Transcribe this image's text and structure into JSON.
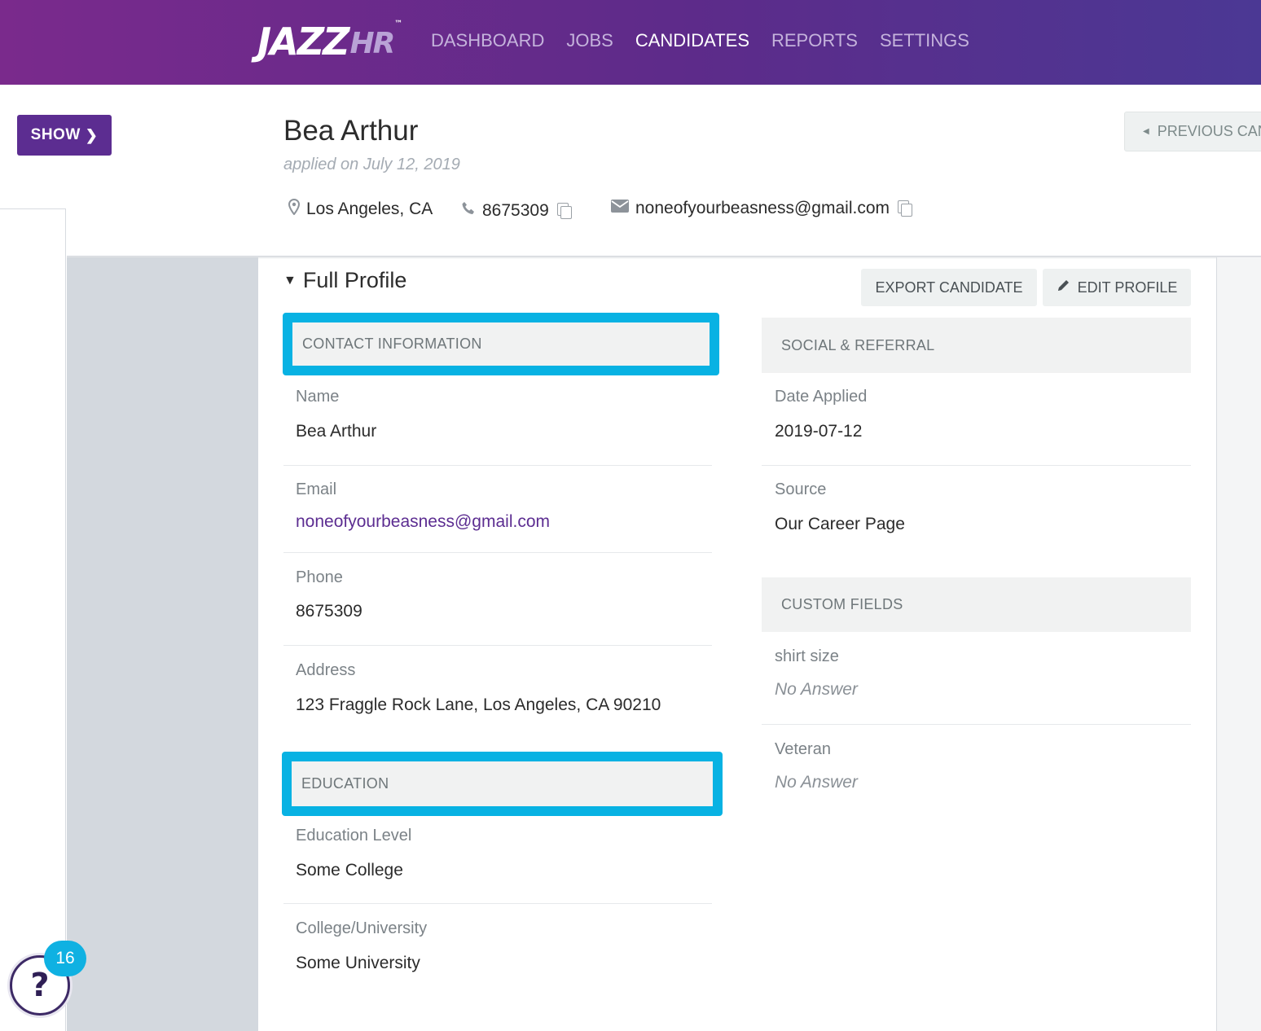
{
  "nav": {
    "logo_main": "JAZZ",
    "logo_accent": "HR",
    "logo_tm": "™",
    "items": [
      {
        "label": "DASHBOARD",
        "active": false
      },
      {
        "label": "JOBS",
        "active": false
      },
      {
        "label": "CANDIDATES",
        "active": true
      },
      {
        "label": "REPORTS",
        "active": false
      },
      {
        "label": "SETTINGS",
        "active": false
      }
    ]
  },
  "sidebar": {
    "show_label": "SHOW",
    "show_icon": "chevron-right-icon"
  },
  "candidate": {
    "name": "Bea Arthur",
    "applied_text": "applied on July 12, 2019",
    "location": "Los Angeles, CA",
    "phone": "8675309",
    "email": "noneofyourbeasness@gmail.com"
  },
  "pager": {
    "previous_label": "PREVIOUS CAN"
  },
  "profile": {
    "toggle_label": "Full Profile",
    "export_label": "EXPORT CANDIDATE",
    "edit_label": "EDIT PROFILE",
    "contact": {
      "title": "CONTACT INFORMATION",
      "fields": [
        {
          "label": "Name",
          "value": "Bea Arthur"
        },
        {
          "label": "Email",
          "value": "noneofyourbeasness@gmail.com"
        },
        {
          "label": "Phone",
          "value": "8675309"
        },
        {
          "label": "Address",
          "value": "123 Fraggle Rock Lane, Los Angeles, CA 90210"
        }
      ]
    },
    "education": {
      "title": "EDUCATION",
      "fields": [
        {
          "label": "Education Level",
          "value": "Some College"
        },
        {
          "label": "College/University",
          "value": "Some University"
        }
      ]
    },
    "social": {
      "title": "SOCIAL & REFERRAL",
      "fields": [
        {
          "label": "Date Applied",
          "value": "2019-07-12"
        },
        {
          "label": "Source",
          "value": "Our Career Page"
        }
      ]
    },
    "custom": {
      "title": "CUSTOM FIELDS",
      "fields": [
        {
          "label": "shirt size",
          "value": "No Answer"
        },
        {
          "label": "Veteran",
          "value": "No Answer"
        }
      ]
    }
  },
  "help": {
    "badge_count": "16",
    "icon_glyph": "?"
  },
  "colors": {
    "brand_purple": "#5c2d91",
    "highlight_blue": "#08b2e3",
    "section_bg": "#f1f2f2"
  }
}
